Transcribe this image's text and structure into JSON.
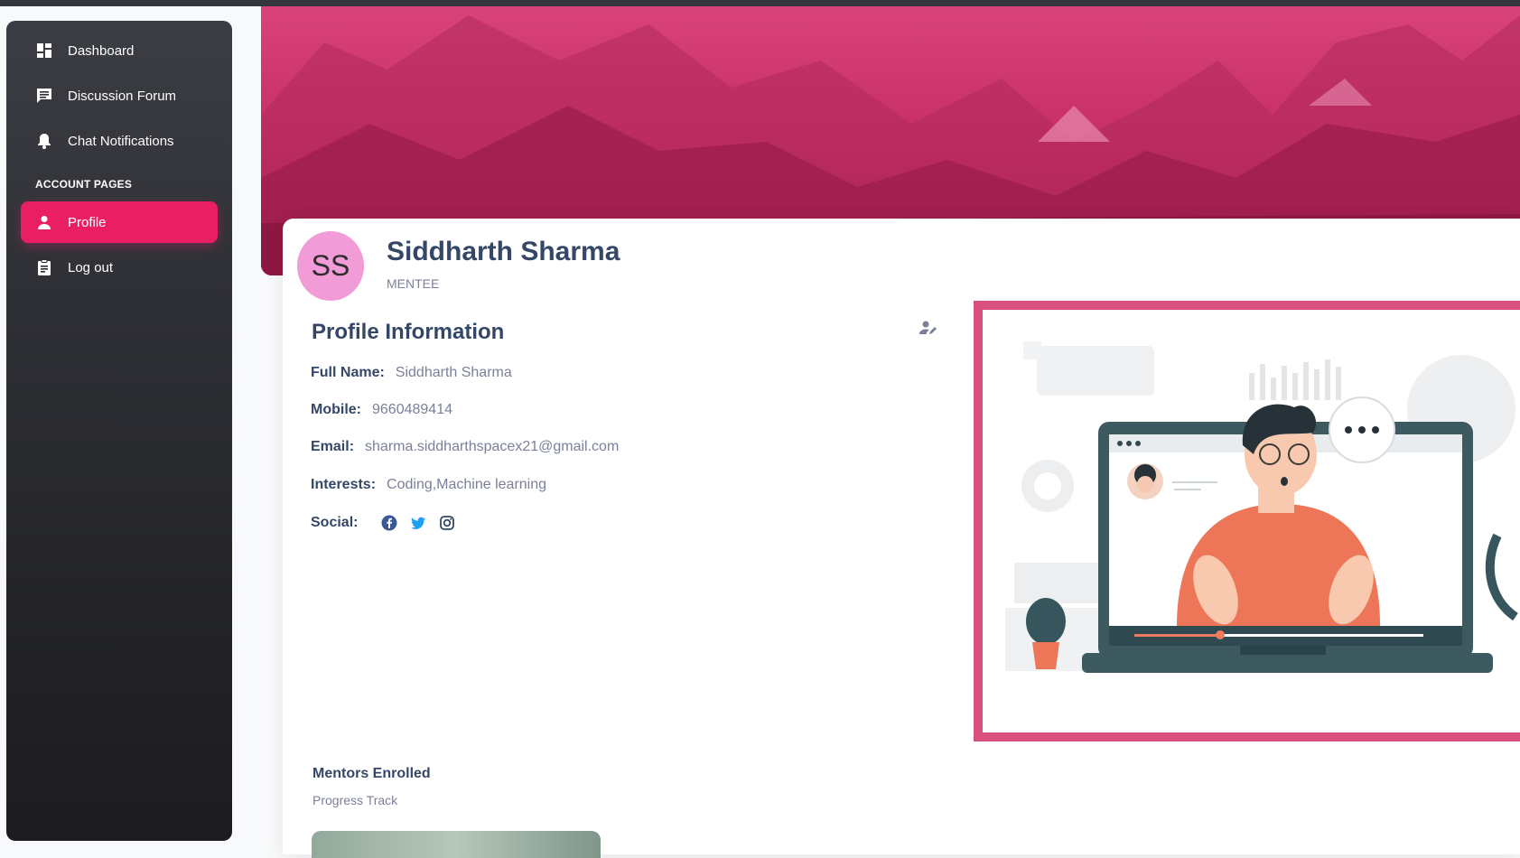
{
  "sidebar": {
    "items": [
      {
        "label": "Dashboard",
        "icon": "dashboard-icon"
      },
      {
        "label": "Discussion Forum",
        "icon": "forum-icon"
      },
      {
        "label": "Chat Notifications",
        "icon": "bell-icon"
      }
    ],
    "section_title": "ACCOUNT PAGES",
    "account_items": [
      {
        "label": "Profile",
        "icon": "person-icon",
        "active": true
      },
      {
        "label": "Log out",
        "icon": "clipboard-icon"
      }
    ]
  },
  "profile": {
    "initials": "SS",
    "name": "Siddharth Sharma",
    "role": "MENTEE"
  },
  "info": {
    "title": "Profile Information",
    "rows": [
      {
        "label": "Full Name:",
        "value": "Siddharth Sharma"
      },
      {
        "label": "Mobile:",
        "value": "9660489414"
      },
      {
        "label": "Email:",
        "value": "sharma.siddharthspacex21@gmail.com"
      },
      {
        "label": "Interests:",
        "value": "Coding,Machine learning"
      }
    ],
    "social_label": "Social:",
    "social": [
      "facebook-icon",
      "twitter-icon",
      "instagram-icon"
    ]
  },
  "mentors": {
    "title": "Mentors Enrolled",
    "subtitle": "Progress Track"
  },
  "colors": {
    "accent": "#e91e63",
    "banner": "#c42c63",
    "frame": "#d94f80",
    "text_dark": "#344767",
    "text_muted": "#7b809a"
  }
}
